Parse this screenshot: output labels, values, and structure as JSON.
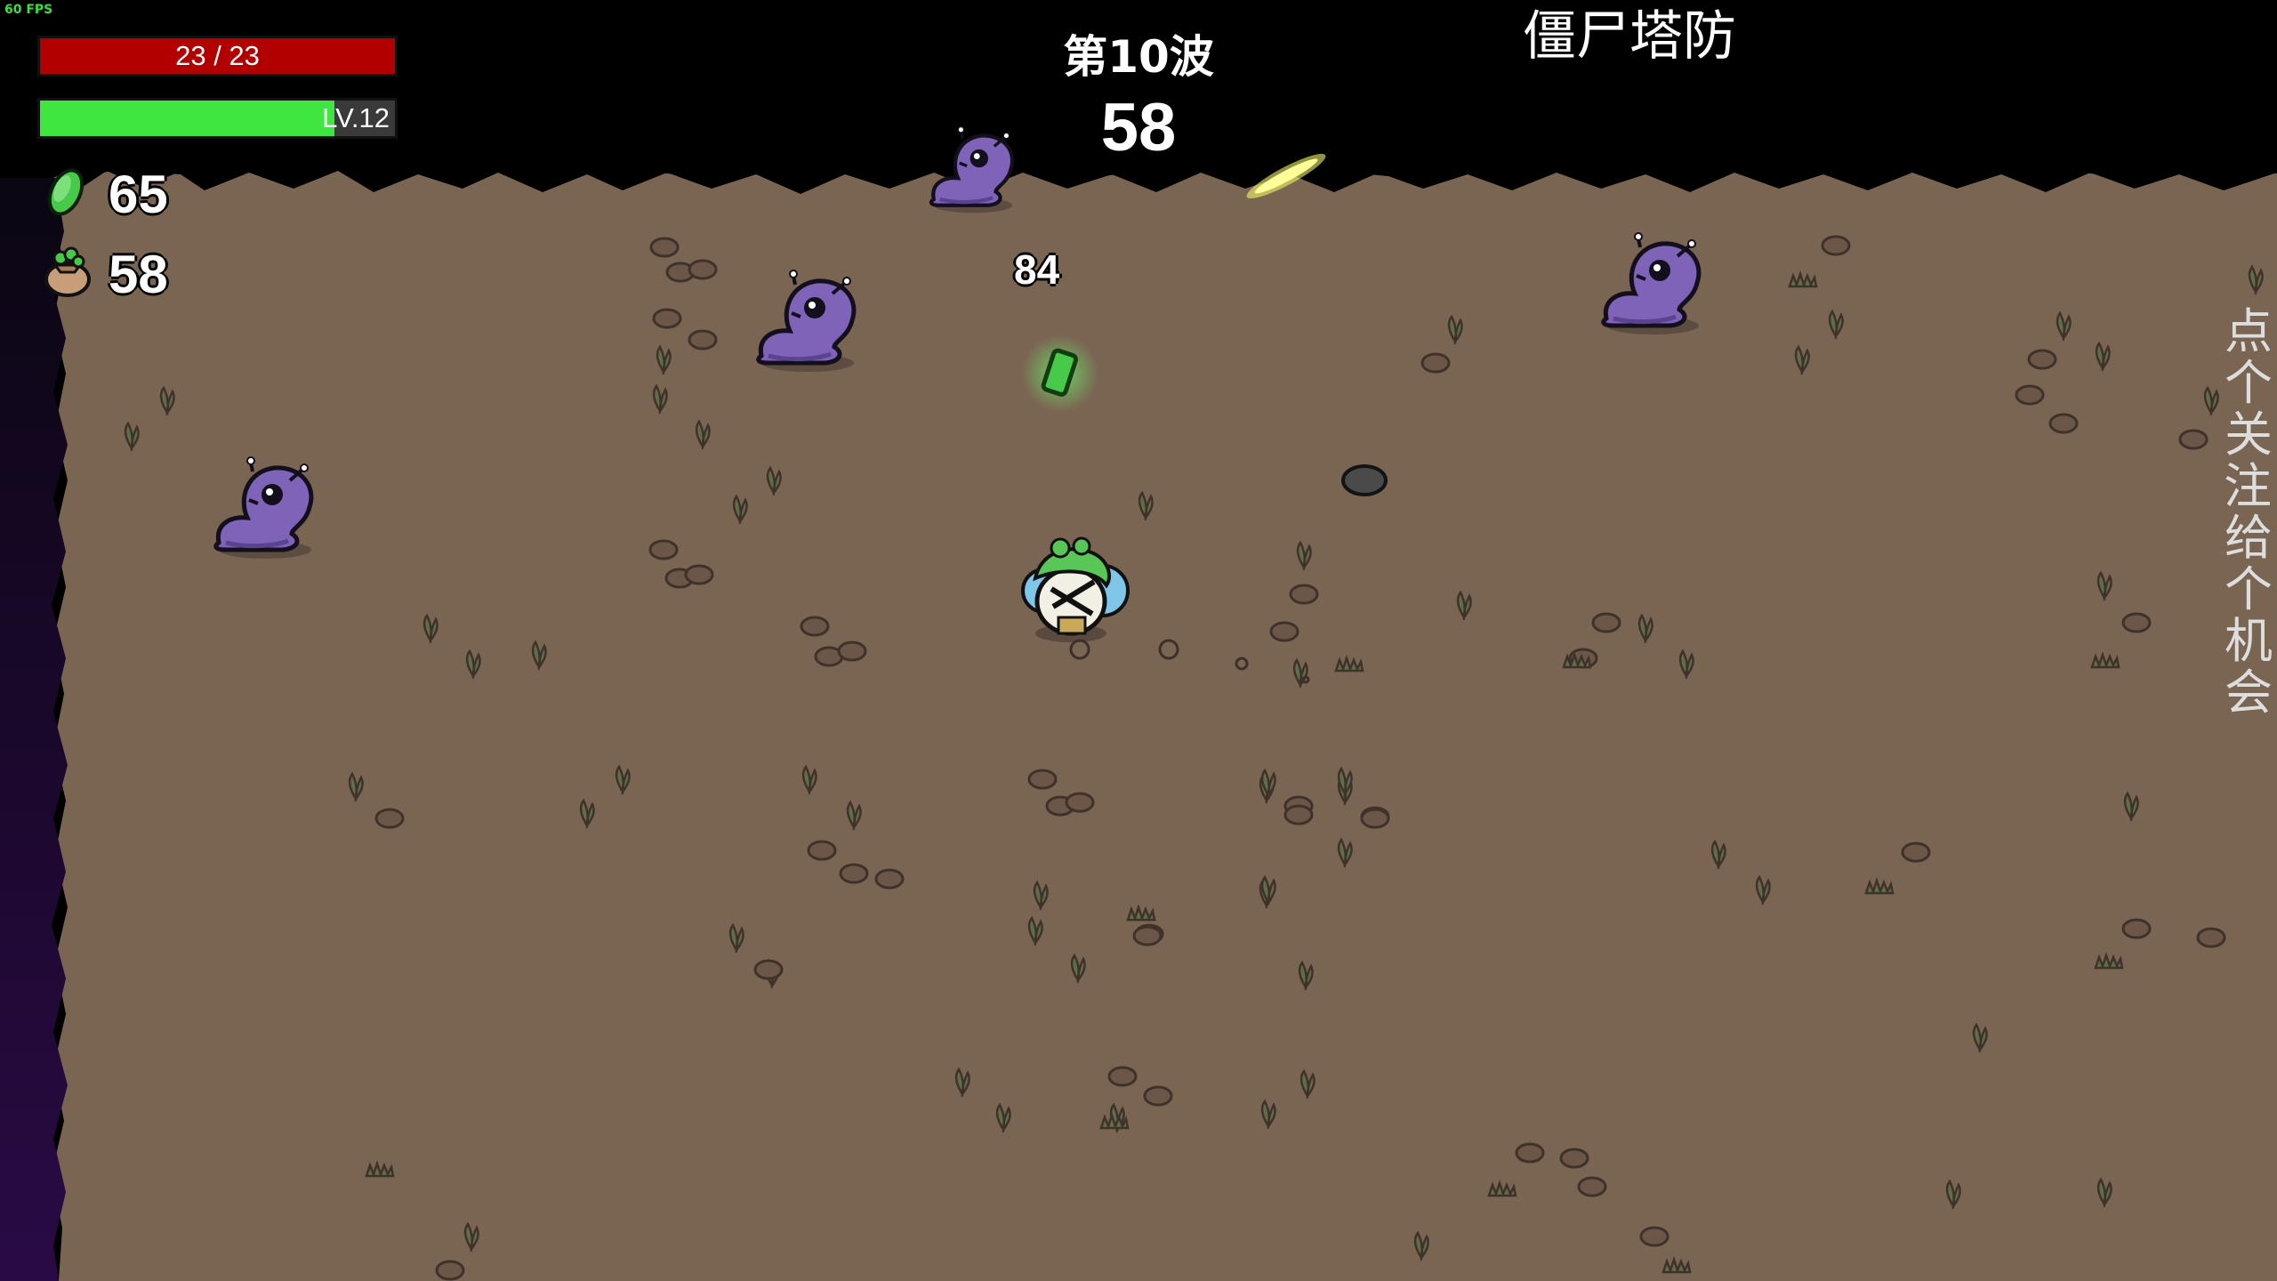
{
  "hud": {
    "fps": "60 FPS",
    "health": {
      "text": "23 / 23",
      "current": 23,
      "max": 23,
      "color": "#b20000"
    },
    "experience": {
      "level_text": "LV.12",
      "fill_fraction": 0.83,
      "color": "#3fe63f"
    },
    "materials": {
      "value": "65",
      "icon": "green-material-icon"
    },
    "bag": {
      "value": "58",
      "icon": "material-bag-icon"
    },
    "wave_label": "第10波",
    "timer": "58",
    "game_title": "僵尸塔防",
    "side_message": "点个关注，给个机会"
  },
  "game": {
    "floating_damage": "84",
    "ground_color": "#7a6452",
    "enemies": [
      "purple-slug-enemy",
      "purple-slug-enemy",
      "purple-slug-enemy",
      "purple-slug-enemy"
    ],
    "player": "potato-player-character",
    "pickup": "green-material-pickup",
    "projectile": "yellow-projectile"
  }
}
